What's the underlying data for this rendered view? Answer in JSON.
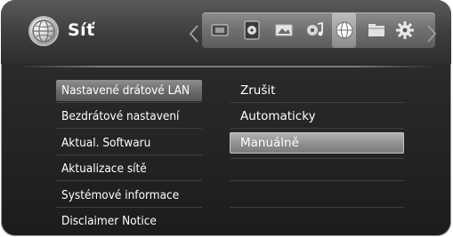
{
  "header": {
    "title": "Síť",
    "logo_icon": "network-globe-icon",
    "nav_left_icon": "chevron-left-icon",
    "nav_right_icon": "chevron-right-icon",
    "icons": [
      {
        "name": "movie-icon",
        "active": false
      },
      {
        "name": "disc-icon",
        "active": false
      },
      {
        "name": "photo-icon",
        "active": false
      },
      {
        "name": "music-icon",
        "active": false
      },
      {
        "name": "network-icon",
        "active": true
      },
      {
        "name": "folder-icon",
        "active": false
      },
      {
        "name": "settings-gear-icon",
        "active": false
      }
    ]
  },
  "menu": {
    "items": [
      {
        "label": "Nastavené drátové LAN",
        "selected": true
      },
      {
        "label": "Bezdrátové nastavení",
        "selected": false
      },
      {
        "label": "Aktual. Softwaru",
        "selected": false
      },
      {
        "label": "Aktualizace sítě",
        "selected": false
      },
      {
        "label": "Systémové informace",
        "selected": false
      },
      {
        "label": "Disclaimer Notice",
        "selected": false
      }
    ]
  },
  "options": {
    "items": [
      {
        "label": "Zrušit",
        "selected": false
      },
      {
        "label": "Automaticky",
        "selected": false
      },
      {
        "label": "Manuálně",
        "selected": true
      }
    ]
  }
}
